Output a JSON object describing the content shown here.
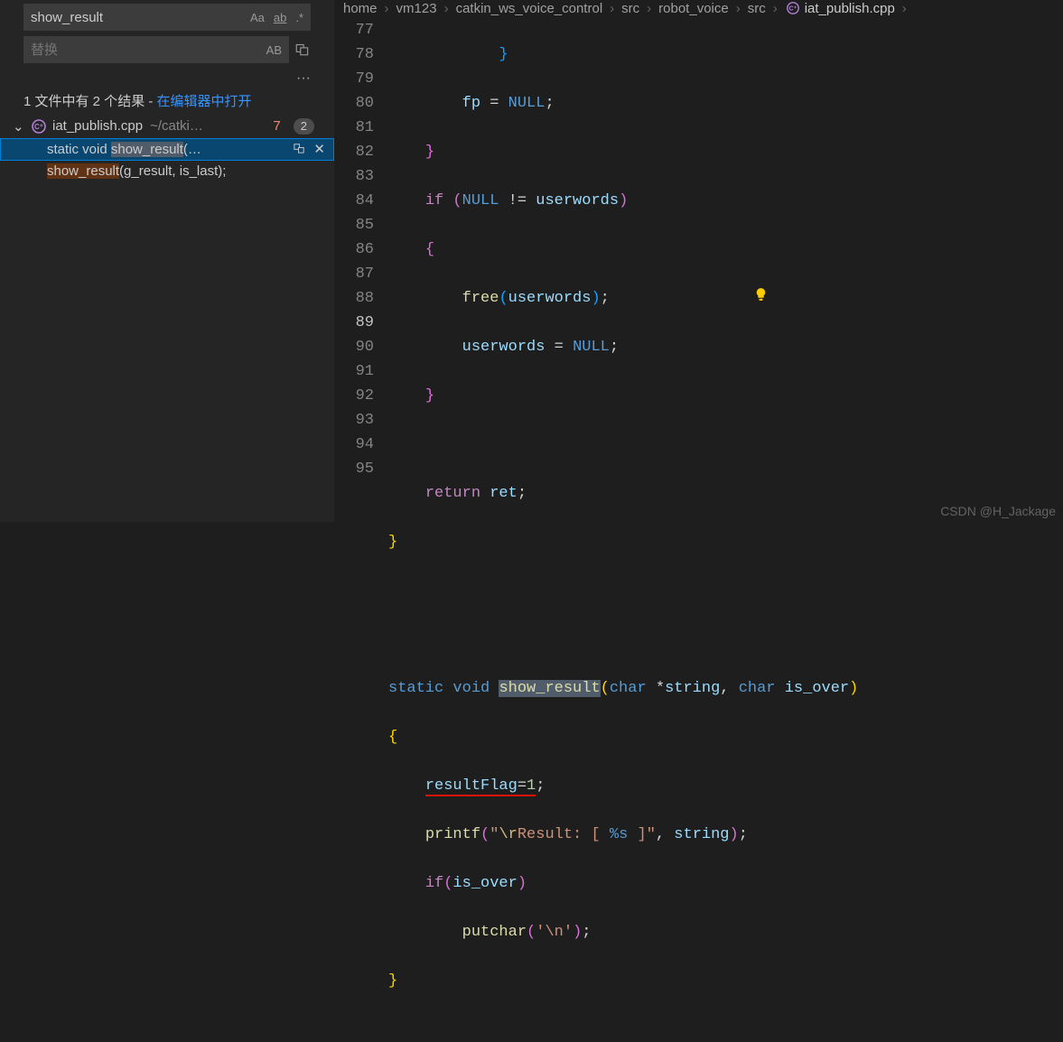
{
  "search": {
    "value": "show_result",
    "caseLabel": "Aa",
    "wordLabel": "ab",
    "regexLabel": ".*"
  },
  "replace": {
    "placeholder": "替换",
    "preserveLabel": "AB"
  },
  "ellipsis": "···",
  "status": {
    "prefix": "1 文件中有 2 个结果 - ",
    "link": "在编辑器中打开"
  },
  "fileResult": {
    "chevron": "⌄",
    "name": "iat_publish.cpp",
    "path": "~/catki…",
    "hintCount": "7",
    "badge": "2"
  },
  "matches": [
    {
      "before": "static void ",
      "hl": "show_result",
      "after": "(…"
    },
    {
      "before": "",
      "hl": "show_result",
      "after": "(g_result, is_last);"
    }
  ],
  "breadcrumbs": [
    "home",
    "vm123",
    "catkin_ws_voice_control",
    "src",
    "robot_voice",
    "src"
  ],
  "breadcrumbLastIcon": "C",
  "breadcrumbLast": "iat_publish.cpp",
  "breadcrumbSep": "›",
  "lineNumbers": [
    "",
    "77",
    "78",
    "79",
    "80",
    "81",
    "82",
    "83",
    "84",
    "85",
    "86",
    "87",
    "88",
    "89",
    "90",
    "91",
    "92",
    "93",
    "94",
    "95"
  ],
  "currentLineNum": "89",
  "code": {
    "l77": {
      "id": "fp",
      "null": "NULL"
    },
    "l79_if": "if",
    "l79_null": "NULL",
    "l79_id": "userwords",
    "l81_free": "free",
    "l81_id": "userwords",
    "l82_id": "userwords",
    "l82_null": "NULL",
    "l85_ret": "return",
    "l85_id": "ret",
    "l89_static": "static",
    "l89_void": "void",
    "l89_fn": "show_result",
    "l89_char1": "char",
    "l89_p1": "string",
    "l89_char2": "char",
    "l89_p2": "is_over",
    "l91_id": "resultFlag",
    "l91_eq": "=",
    "l91_num": "1",
    "l92_printf": "printf",
    "l92_esc1": "\\r",
    "l92_str_a": "Result: [ ",
    "l92_fmt": "%s",
    "l92_str_b": " ]",
    "l92_arg": "string",
    "l93_if": "if",
    "l93_id": "is_over",
    "l94_put": "putchar",
    "l94_esc": "'\\n'"
  },
  "watermark": "CSDN @H_Jackage"
}
